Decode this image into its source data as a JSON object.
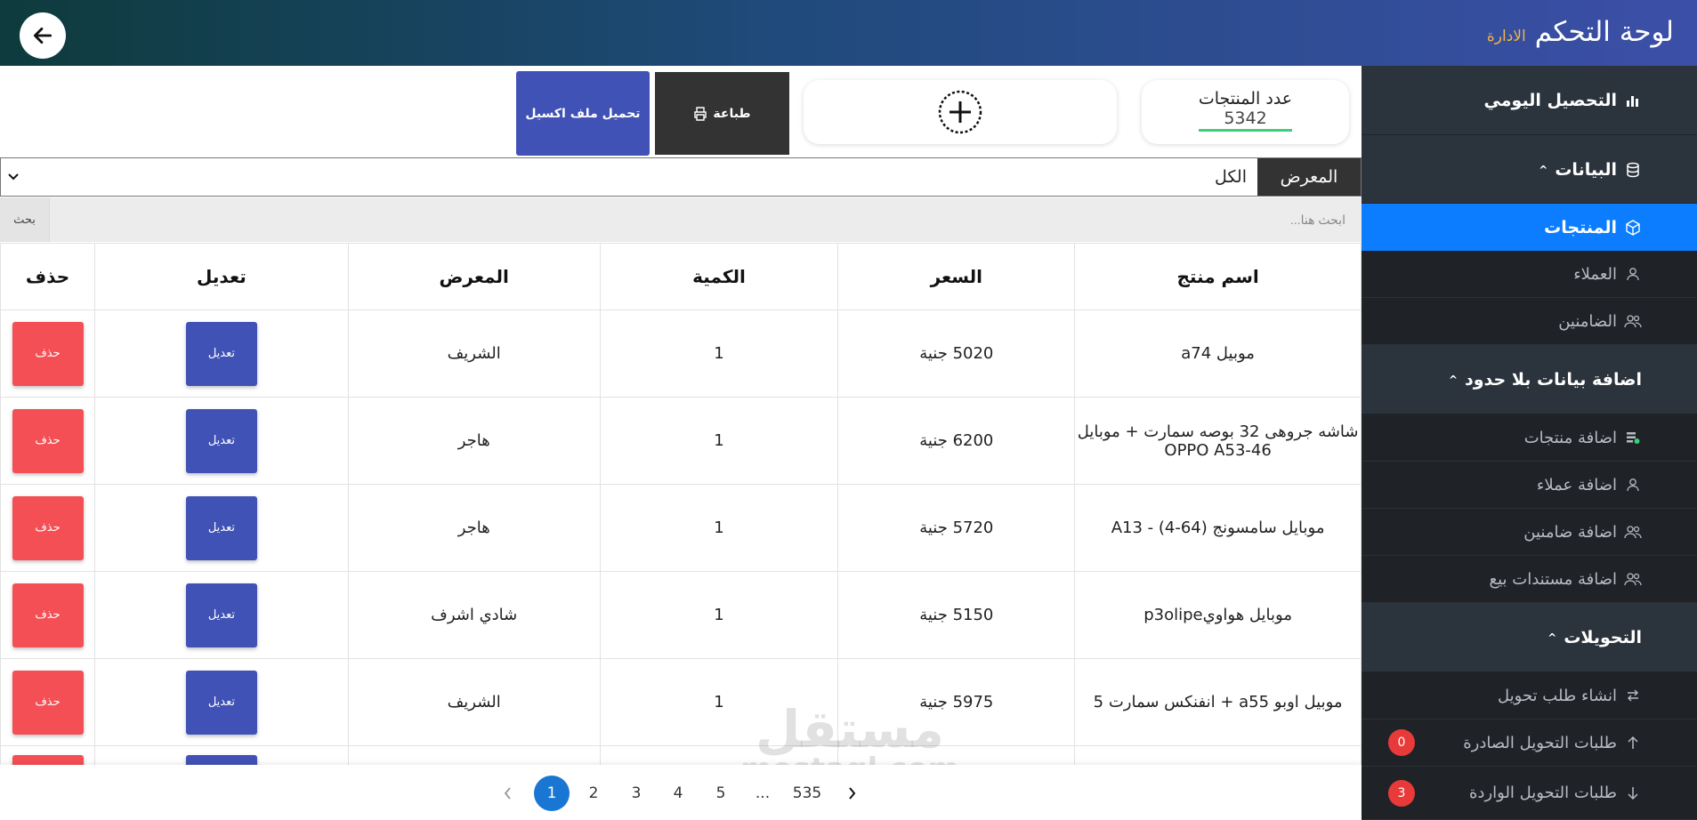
{
  "header": {
    "title": "لوحة التحكم",
    "subtitle": "الادارة"
  },
  "sidebar": {
    "daily_collection": "التحصيل اليومي",
    "data_section": "البيانات",
    "products": "المنتجات",
    "customers": "العملاء",
    "guarantors": "الضامنين",
    "add_data_section": "اضافة بيانات بلا حدود",
    "add_products": "اضافة منتجات",
    "add_customers": "اضافة عملاء",
    "add_guarantors": "اضافة ضامنين",
    "add_sale_docs": "اضافة مستندات بيع",
    "transfers_section": "التحويلات",
    "create_transfer": "انشاء طلب تحويل",
    "outgoing_transfers": "طلبات التحويل الصادرة",
    "outgoing_count": "0",
    "incoming_transfers": "طلبات التحويل الواردة",
    "incoming_count": "3"
  },
  "toolbar": {
    "count_label": "عدد المنتجات",
    "count_value": "5342",
    "print_label": "طباعة",
    "excel_label": "تحميل ملف اكسيل"
  },
  "filter": {
    "label": "المعرض",
    "selected": "الكل"
  },
  "search": {
    "placeholder": "ابحث هنا...",
    "button": "بحث"
  },
  "table": {
    "headers": {
      "name": "اسم منتج",
      "price": "السعر",
      "qty": "الكمية",
      "showroom": "المعرض",
      "edit": "تعديل",
      "delete": "حذف"
    },
    "edit_label": "تعديل",
    "delete_label": "حذف",
    "rows": [
      {
        "name": "موبيل a74",
        "price": "5020 جنية",
        "qty": "1",
        "showroom": "الشريف"
      },
      {
        "name": "شاشه جروهى 32 بوصه سمارت + موبايل OPPO A53-46",
        "price": "6200 جنية",
        "qty": "1",
        "showroom": "هاجر"
      },
      {
        "name": "موبايل سامسونج (64-4) - A13",
        "price": "5720 جنية",
        "qty": "1",
        "showroom": "هاجر"
      },
      {
        "name": "موبايل هواويp3olipe",
        "price": "5150 جنية",
        "qty": "1",
        "showroom": "شادي اشرف"
      },
      {
        "name": "موبيل اوبو a55 + انفنكس سمارت 5",
        "price": "5975 جنية",
        "qty": "1",
        "showroom": "الشريف"
      }
    ]
  },
  "pagination": {
    "pages": [
      "1",
      "2",
      "3",
      "4",
      "5"
    ],
    "ellipsis": "...",
    "last": "535",
    "current": "1"
  },
  "watermark": {
    "line1": "مستقل",
    "line2": "mostaql.com"
  },
  "colors": {
    "accent": "#0d7dff",
    "primary_button": "#4052b5",
    "danger": "#f44f54",
    "sidebar": "#2b333c"
  }
}
